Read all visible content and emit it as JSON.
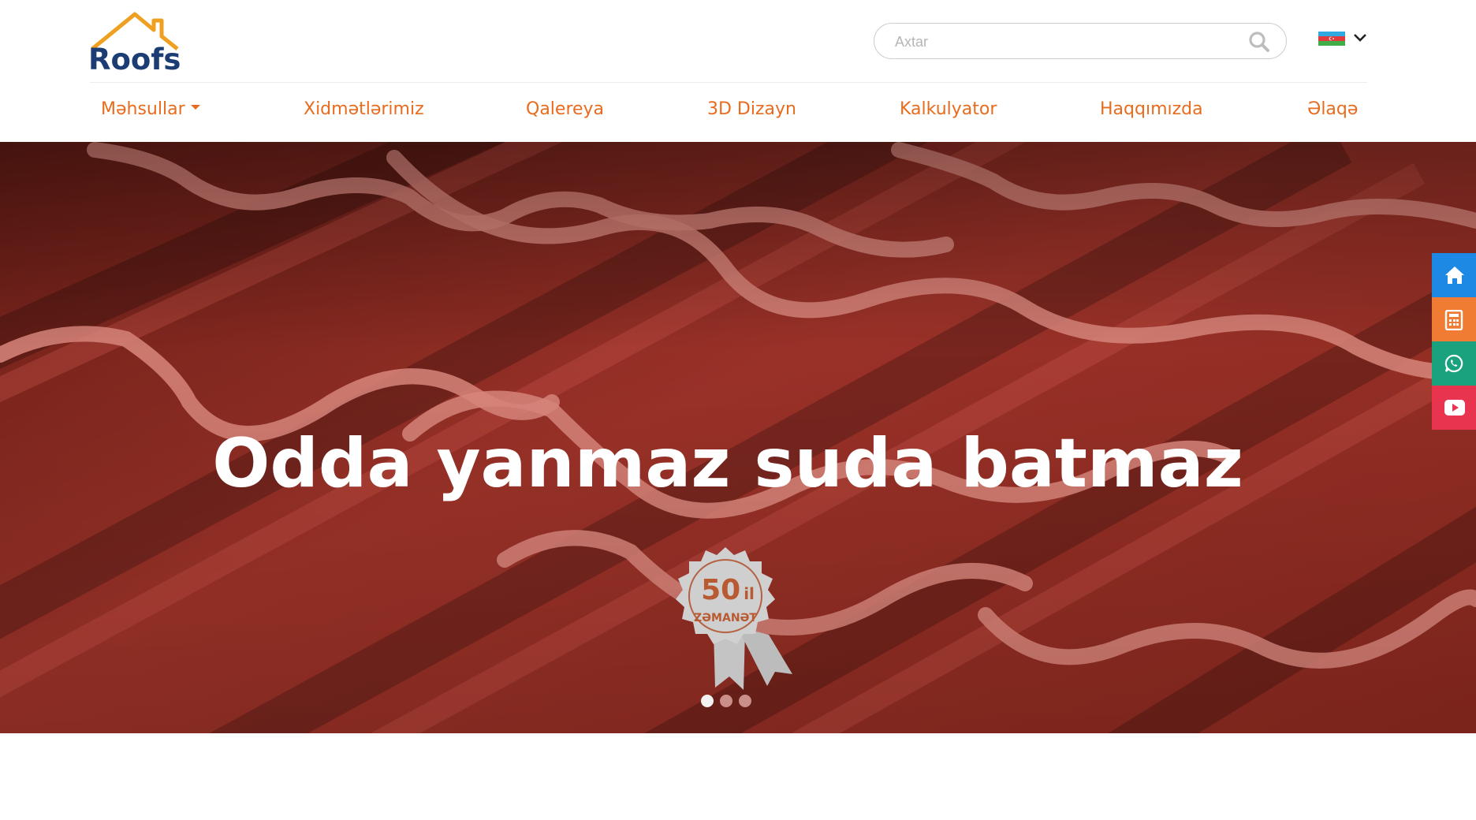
{
  "brand": {
    "logo_text": "Roofs"
  },
  "search": {
    "placeholder": "Axtar",
    "value": ""
  },
  "language": {
    "flag": "azerbaijan-flag",
    "current": "AZ"
  },
  "nav": {
    "items": [
      {
        "label": "Məhsullar",
        "has_dropdown": true
      },
      {
        "label": "Xidmətlərimiz"
      },
      {
        "label": "Qalereya"
      },
      {
        "label": "3D Dizayn"
      },
      {
        "label": "Kalkulyator"
      },
      {
        "label": "Haqqımızda"
      },
      {
        "label": "Əlaqə"
      }
    ]
  },
  "hero": {
    "title": "Odda yanmaz suda batmaz",
    "badge": {
      "number": "50",
      "unit": "il",
      "label": "ZƏMANƏT"
    },
    "slides_total": 3,
    "active_slide": 1
  },
  "side_buttons": [
    {
      "icon": "home-icon",
      "color": "#1e88e5"
    },
    {
      "icon": "calculator-icon",
      "color": "#ef7c32"
    },
    {
      "icon": "whatsapp-icon",
      "color": "#1aa27f"
    },
    {
      "icon": "youtube-icon",
      "color": "#e8344f"
    }
  ],
  "colors": {
    "accent": "#e96b1d",
    "brand_blue": "#1b3d74",
    "hero_red": "#9c2e22"
  }
}
